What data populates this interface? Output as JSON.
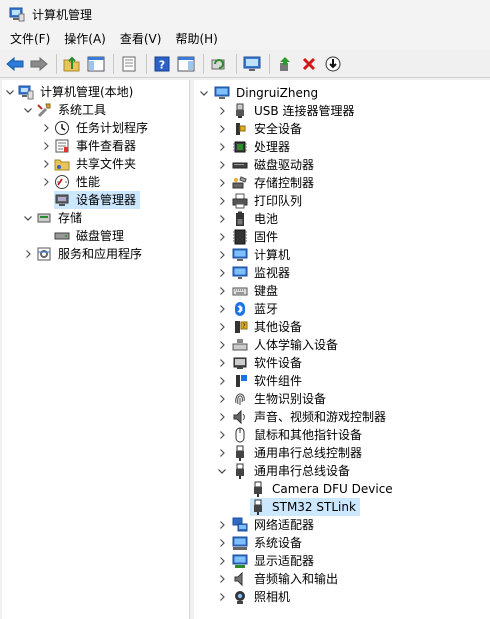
{
  "window": {
    "title": "计算机管理"
  },
  "menu": [
    "文件(F)",
    "操作(A)",
    "查看(V)",
    "帮助(H)"
  ],
  "left_tree": [
    {
      "label": "计算机管理(本地)",
      "level": 0,
      "expand": "down",
      "icon": "computer-management-icon"
    },
    {
      "label": "系统工具",
      "level": 1,
      "expand": "down",
      "icon": "tools-icon"
    },
    {
      "label": "任务计划程序",
      "level": 2,
      "expand": "right",
      "icon": "clock-icon"
    },
    {
      "label": "事件查看器",
      "level": 2,
      "expand": "right",
      "icon": "event-viewer-icon"
    },
    {
      "label": "共享文件夹",
      "level": 2,
      "expand": "right",
      "icon": "shared-folder-icon"
    },
    {
      "label": "性能",
      "level": 2,
      "expand": "right",
      "icon": "performance-icon"
    },
    {
      "label": "设备管理器",
      "level": 2,
      "expand": "none",
      "icon": "device-manager-icon",
      "selected": true
    },
    {
      "label": "存储",
      "level": 1,
      "expand": "down",
      "icon": "storage-icon"
    },
    {
      "label": "磁盘管理",
      "level": 2,
      "expand": "none",
      "icon": "disk-management-icon"
    },
    {
      "label": "服务和应用程序",
      "level": 1,
      "expand": "right",
      "icon": "services-icon"
    }
  ],
  "right_tree": [
    {
      "label": "DingruiZheng",
      "level": 0,
      "expand": "down",
      "icon": "computer-icon"
    },
    {
      "label": "USB 连接器管理器",
      "level": 1,
      "expand": "right",
      "icon": "usb-connector-icon"
    },
    {
      "label": "安全设备",
      "level": 1,
      "expand": "right",
      "icon": "security-device-icon"
    },
    {
      "label": "处理器",
      "level": 1,
      "expand": "right",
      "icon": "processor-icon"
    },
    {
      "label": "磁盘驱动器",
      "level": 1,
      "expand": "right",
      "icon": "disk-drive-icon"
    },
    {
      "label": "存储控制器",
      "level": 1,
      "expand": "right",
      "icon": "storage-controller-icon"
    },
    {
      "label": "打印队列",
      "level": 1,
      "expand": "right",
      "icon": "printer-icon"
    },
    {
      "label": "电池",
      "level": 1,
      "expand": "right",
      "icon": "battery-icon"
    },
    {
      "label": "固件",
      "level": 1,
      "expand": "right",
      "icon": "firmware-icon"
    },
    {
      "label": "计算机",
      "level": 1,
      "expand": "right",
      "icon": "computer-icon"
    },
    {
      "label": "监视器",
      "level": 1,
      "expand": "right",
      "icon": "monitor-icon"
    },
    {
      "label": "键盘",
      "level": 1,
      "expand": "right",
      "icon": "keyboard-icon"
    },
    {
      "label": "蓝牙",
      "level": 1,
      "expand": "right",
      "icon": "bluetooth-icon"
    },
    {
      "label": "其他设备",
      "level": 1,
      "expand": "right",
      "icon": "other-devices-icon"
    },
    {
      "label": "人体学输入设备",
      "level": 1,
      "expand": "right",
      "icon": "hid-icon"
    },
    {
      "label": "软件设备",
      "level": 1,
      "expand": "right",
      "icon": "software-device-icon"
    },
    {
      "label": "软件组件",
      "level": 1,
      "expand": "right",
      "icon": "software-component-icon"
    },
    {
      "label": "生物识别设备",
      "level": 1,
      "expand": "right",
      "icon": "fingerprint-icon"
    },
    {
      "label": "声音、视频和游戏控制器",
      "level": 1,
      "expand": "right",
      "icon": "speaker-icon"
    },
    {
      "label": "鼠标和其他指针设备",
      "level": 1,
      "expand": "right",
      "icon": "mouse-icon"
    },
    {
      "label": "通用串行总线控制器",
      "level": 1,
      "expand": "right",
      "icon": "usb-plug-icon"
    },
    {
      "label": "通用串行总线设备",
      "level": 1,
      "expand": "down",
      "icon": "usb-plug-icon"
    },
    {
      "label": "Camera DFU Device",
      "level": 2,
      "expand": "none",
      "icon": "usb-plug-icon"
    },
    {
      "label": "STM32 STLink",
      "level": 2,
      "expand": "none",
      "icon": "usb-plug-icon",
      "selected": true
    },
    {
      "label": "网络适配器",
      "level": 1,
      "expand": "right",
      "icon": "network-adapter-icon"
    },
    {
      "label": "系统设备",
      "level": 1,
      "expand": "right",
      "icon": "system-device-icon"
    },
    {
      "label": "显示适配器",
      "level": 1,
      "expand": "right",
      "icon": "display-adapter-icon"
    },
    {
      "label": "音频输入和输出",
      "level": 1,
      "expand": "right",
      "icon": "audio-io-icon"
    },
    {
      "label": "照相机",
      "level": 1,
      "expand": "right",
      "icon": "camera-icon"
    }
  ],
  "colors": {
    "selection": "#cce8ff",
    "accent": "#0067c0"
  }
}
